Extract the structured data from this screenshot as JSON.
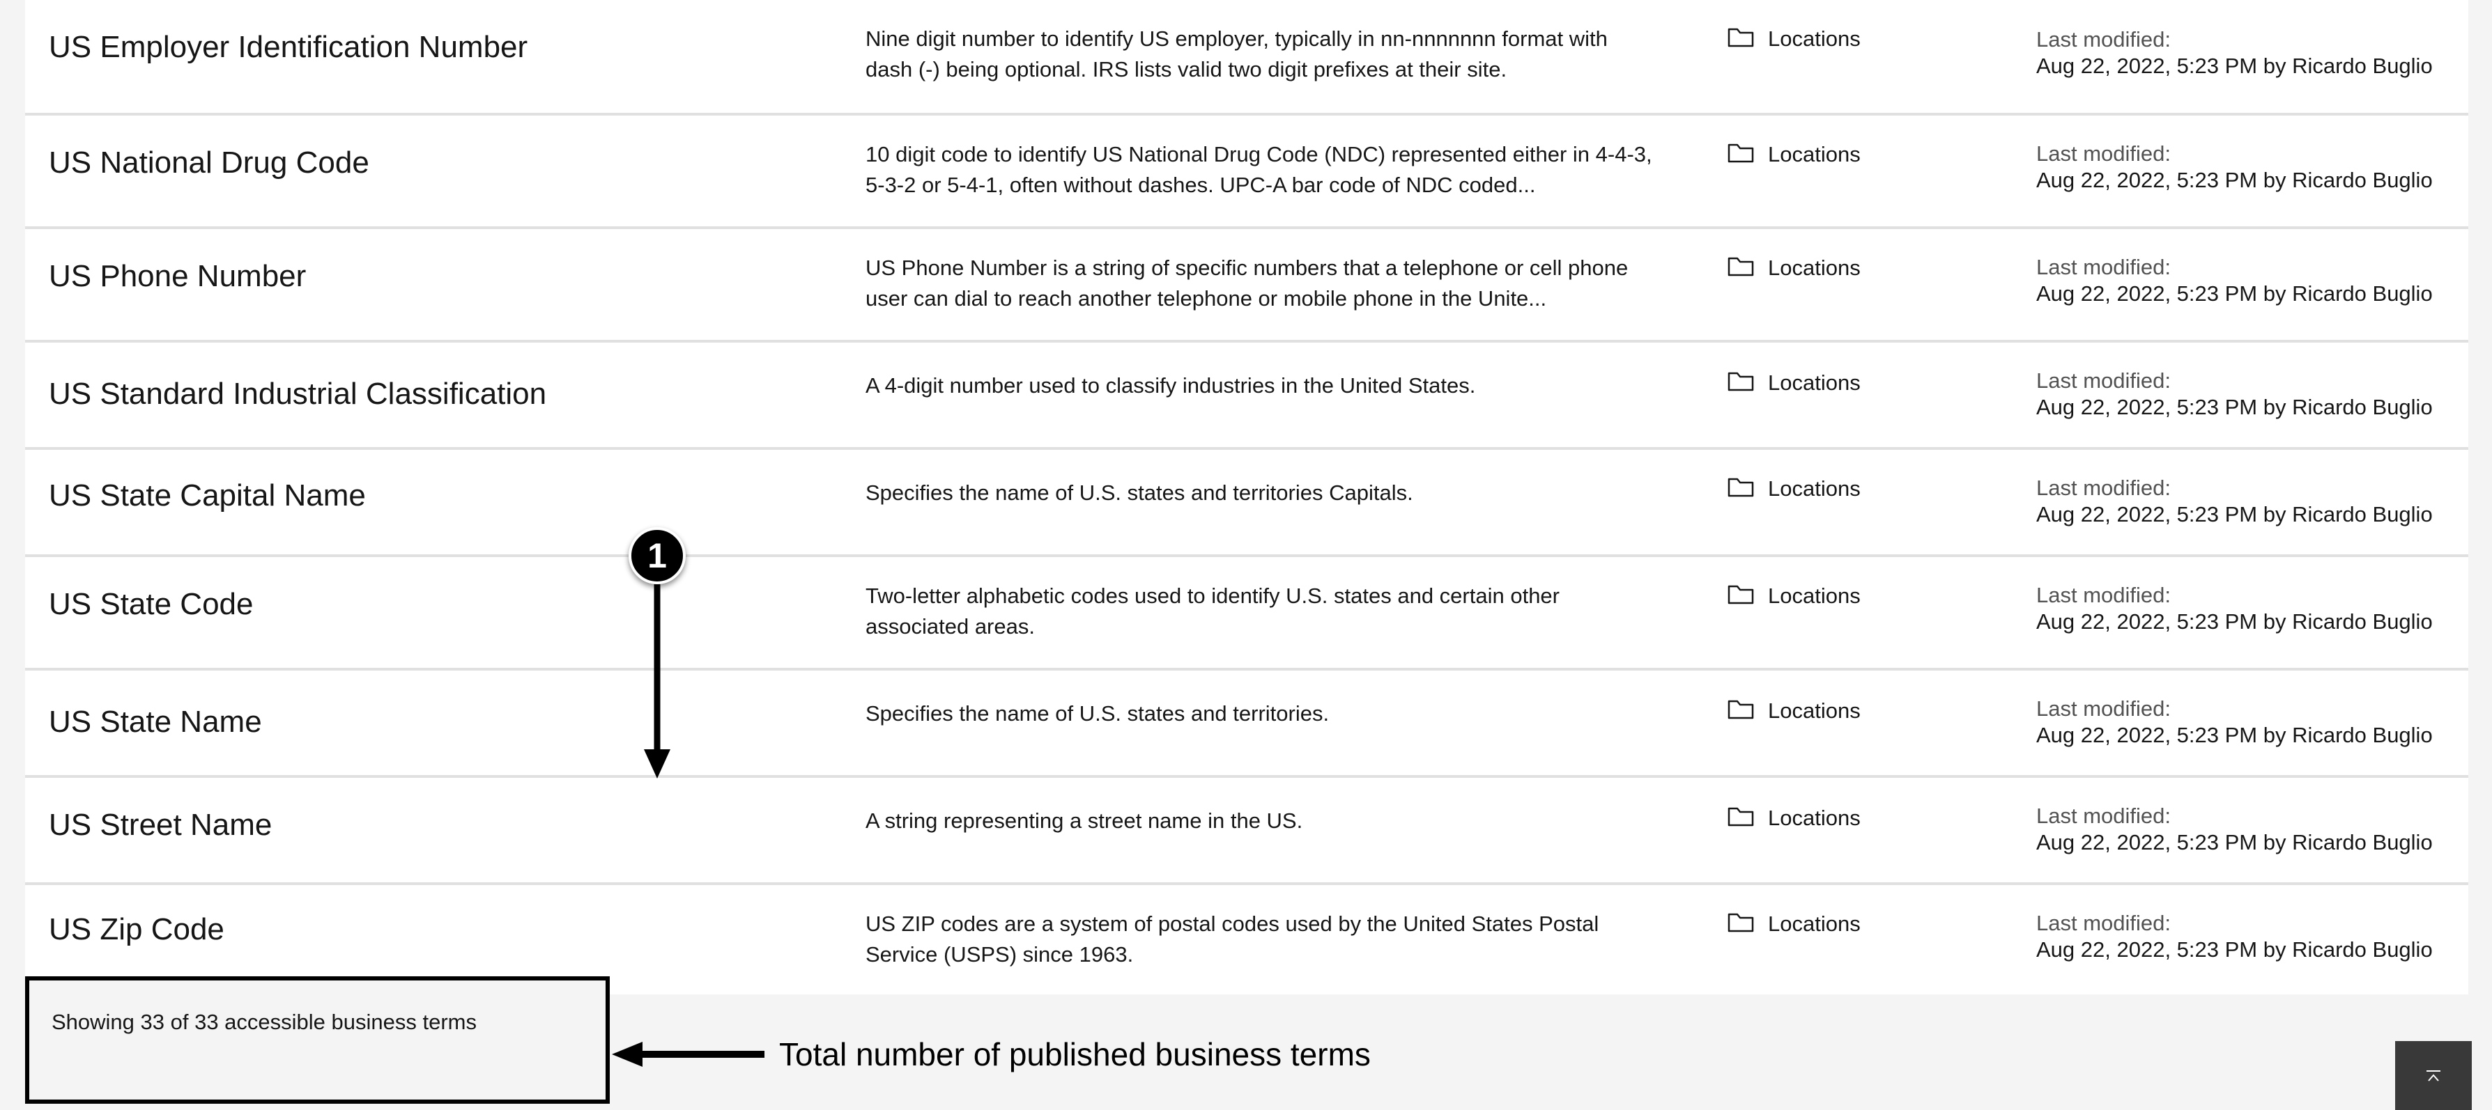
{
  "terms": [
    {
      "name": "US Employer Identification Number",
      "description": "Nine digit number to identify US employer, typically in nn-nnnnnnn format with dash (-) being optional. IRS lists valid two digit prefixes at their site.",
      "category": "Locations",
      "modified_label": "Last modified:",
      "modified_value": "Aug 22, 2022, 5:23 PM by Ricardo Buglio"
    },
    {
      "name": "US National Drug Code",
      "description": "10 digit code to identify US National Drug Code (NDC) represented either in 4-4-3, 5-3-2 or 5-4-1, often without dashes. UPC-A bar code of NDC coded...",
      "category": "Locations",
      "modified_label": "Last modified:",
      "modified_value": "Aug 22, 2022, 5:23 PM by Ricardo Buglio"
    },
    {
      "name": "US Phone Number",
      "description": "US Phone Number is a string of specific numbers that a telephone or cell phone user can dial to reach another telephone or mobile phone in the Unite...",
      "category": "Locations",
      "modified_label": "Last modified:",
      "modified_value": "Aug 22, 2022, 5:23 PM by Ricardo Buglio"
    },
    {
      "name": "US Standard Industrial Classification",
      "description": "A 4-digit number used to classify industries in the United States.",
      "category": "Locations",
      "modified_label": "Last modified:",
      "modified_value": "Aug 22, 2022, 5:23 PM by Ricardo Buglio"
    },
    {
      "name": "US State Capital Name",
      "description": "Specifies the name of U.S. states and territories Capitals.",
      "category": "Locations",
      "modified_label": "Last modified:",
      "modified_value": "Aug 22, 2022, 5:23 PM by Ricardo Buglio"
    },
    {
      "name": "US State Code",
      "description": "Two-letter alphabetic codes used to identify U.S. states and certain other associated areas.",
      "category": "Locations",
      "modified_label": "Last modified:",
      "modified_value": "Aug 22, 2022, 5:23 PM by Ricardo Buglio"
    },
    {
      "name": "US State Name",
      "description": "Specifies the name of U.S. states and territories.",
      "category": "Locations",
      "modified_label": "Last modified:",
      "modified_value": "Aug 22, 2022, 5:23 PM by Ricardo Buglio"
    },
    {
      "name": "US Street Name",
      "description": "A string representing a street name in the US.",
      "category": "Locations",
      "modified_label": "Last modified:",
      "modified_value": "Aug 22, 2022, 5:23 PM by Ricardo Buglio"
    },
    {
      "name": "US Zip Code",
      "description": "US ZIP codes are a system of postal codes used by the United States Postal Service (USPS) since 1963.",
      "category": "Locations",
      "modified_label": "Last modified:",
      "modified_value": "Aug 22, 2022, 5:23 PM by Ricardo Buglio"
    }
  ],
  "footer": {
    "result_count": "Showing 33 of 33 accessible business terms"
  },
  "annotation": {
    "step_number": "1",
    "callout_text": "Total number of published business terms"
  },
  "icons": {
    "category": "folder-icon",
    "back_to_top": "arrow-up-to-top-icon"
  }
}
